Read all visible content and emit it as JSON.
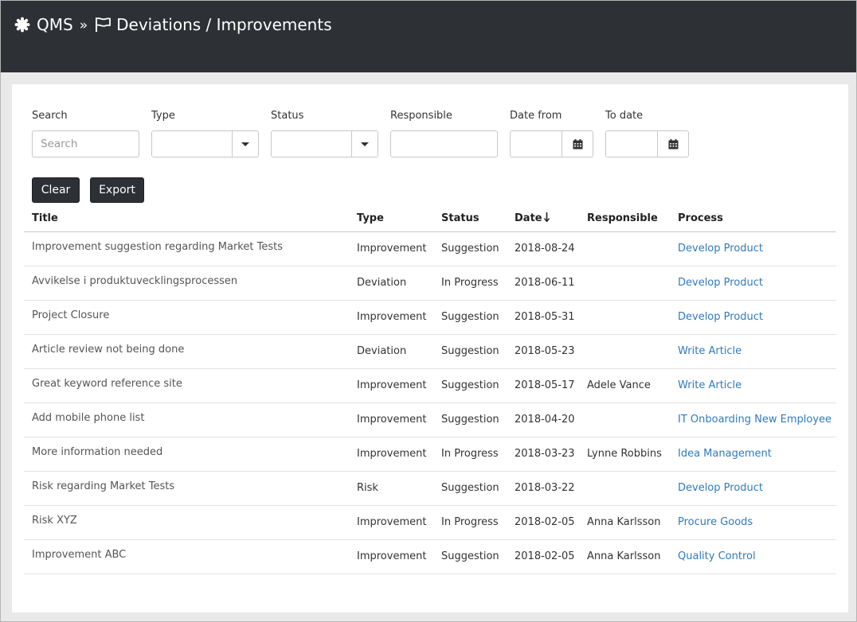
{
  "header": {
    "app": "QMS",
    "separator": "»",
    "page_title": "Deviations / Improvements"
  },
  "filters": {
    "search_label": "Search",
    "search_placeholder": "Search",
    "type_label": "Type",
    "status_label": "Status",
    "responsible_label": "Responsible",
    "date_from_label": "Date from",
    "to_date_label": "To date"
  },
  "buttons": {
    "clear": "Clear",
    "export": "Export"
  },
  "table": {
    "columns": [
      "Title",
      "Type",
      "Status",
      "Date",
      "Responsible",
      "Process"
    ],
    "sort_column": "Date",
    "sort_direction": "descending",
    "rows": [
      {
        "title": "Improvement suggestion regarding Market Tests",
        "type": "Improvement",
        "status": "Suggestion",
        "date": "2018-08-24",
        "responsible": "",
        "process": "Develop Product"
      },
      {
        "title": "Avvikelse i produktuvecklingsprocessen",
        "type": "Deviation",
        "status": "In Progress",
        "date": "2018-06-11",
        "responsible": "",
        "process": "Develop Product"
      },
      {
        "title": "Project Closure",
        "type": "Improvement",
        "status": "Suggestion",
        "date": "2018-05-31",
        "responsible": "",
        "process": "Develop Product"
      },
      {
        "title": "Article review not being done",
        "type": "Deviation",
        "status": "Suggestion",
        "date": "2018-05-23",
        "responsible": "",
        "process": "Write Article"
      },
      {
        "title": "Great keyword reference site",
        "type": "Improvement",
        "status": "Suggestion",
        "date": "2018-05-17",
        "responsible": "Adele Vance",
        "process": "Write Article"
      },
      {
        "title": "Add mobile phone list",
        "type": "Improvement",
        "status": "Suggestion",
        "date": "2018-04-20",
        "responsible": "",
        "process": "IT Onboarding New Employee"
      },
      {
        "title": "More information needed",
        "type": "Improvement",
        "status": "In Progress",
        "date": "2018-03-23",
        "responsible": "Lynne Robbins",
        "process": "Idea Management"
      },
      {
        "title": "Risk regarding Market Tests",
        "type": "Risk",
        "status": "Suggestion",
        "date": "2018-03-22",
        "responsible": "",
        "process": "Develop Product"
      },
      {
        "title": "Risk XYZ",
        "type": "Improvement",
        "status": "In Progress",
        "date": "2018-02-05",
        "responsible": "Anna Karlsson",
        "process": "Procure Goods"
      },
      {
        "title": "Improvement ABC",
        "type": "Improvement",
        "status": "Suggestion",
        "date": "2018-02-05",
        "responsible": "Anna Karlsson",
        "process": "Quality Control"
      }
    ]
  },
  "colors": {
    "header_bg": "#2d3035",
    "link": "#2f7bbd",
    "button_bg": "#2d3035"
  }
}
